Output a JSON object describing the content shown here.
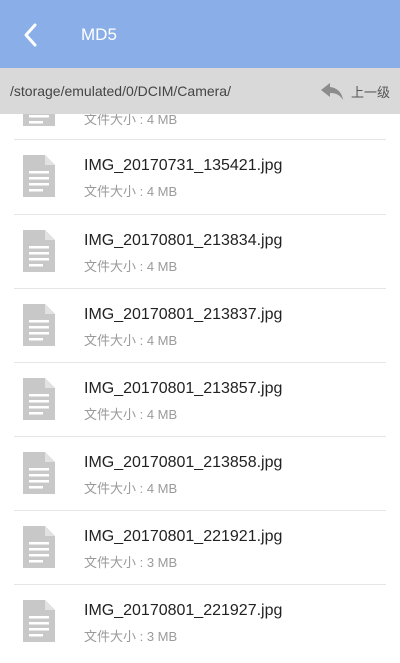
{
  "header": {
    "title": "MD5",
    "back_icon": "chevron-left-icon"
  },
  "pathbar": {
    "path": "/storage/emulated/0/DCIM/Camera/",
    "up_label": "上一级",
    "up_icon": "reply-arrow-icon"
  },
  "files": {
    "partial_item": {
      "size": "文件大小 : 4 MB"
    },
    "items": [
      {
        "name": "IMG_20170731_135421.jpg",
        "size": "文件大小 : 4 MB"
      },
      {
        "name": "IMG_20170801_213834.jpg",
        "size": "文件大小 : 4 MB"
      },
      {
        "name": "IMG_20170801_213837.jpg",
        "size": "文件大小 : 4 MB"
      },
      {
        "name": "IMG_20170801_213857.jpg",
        "size": "文件大小 : 4 MB"
      },
      {
        "name": "IMG_20170801_213858.jpg",
        "size": "文件大小 : 4 MB"
      },
      {
        "name": "IMG_20170801_221921.jpg",
        "size": "文件大小 : 3 MB"
      },
      {
        "name": "IMG_20170801_221927.jpg",
        "size": "文件大小 : 3 MB"
      }
    ]
  },
  "colors": {
    "appbar": "#8aaee8",
    "pathbar": "#d9d9d9",
    "icon": "#c8c8c8"
  }
}
